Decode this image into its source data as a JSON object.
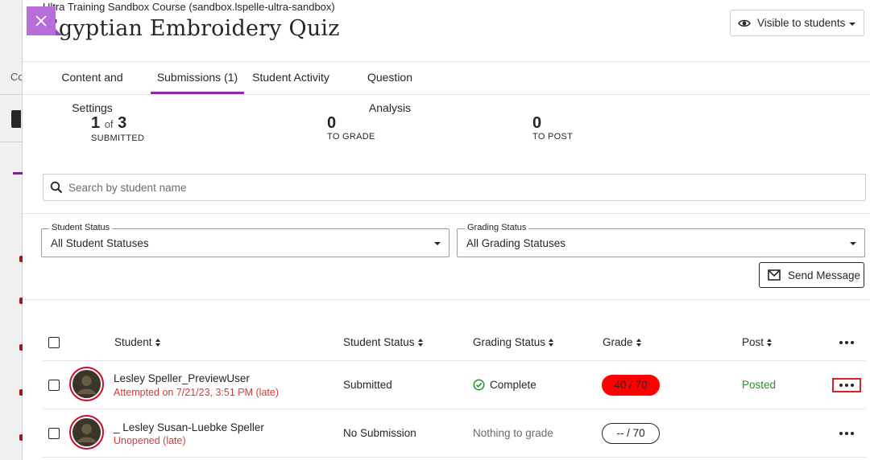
{
  "background": {
    "partial_text": "Co"
  },
  "header": {
    "course_name": "Ultra Training Sandbox Course (sandbox.lspelle-ultra-sandbox)",
    "title": "Egyptian Embroidery Quiz",
    "visibility_label": "Visible to students"
  },
  "tabs": [
    {
      "label": "Content and Settings",
      "active": false
    },
    {
      "label": "Submissions (1)",
      "active": true
    },
    {
      "label": "Student Activity",
      "active": false
    },
    {
      "label": "Question Analysis",
      "active": false
    }
  ],
  "stats": {
    "submitted": {
      "count": "1",
      "of_word": "of",
      "total": "3",
      "label": "SUBMITTED"
    },
    "to_grade": {
      "count": "0",
      "label": "TO GRADE"
    },
    "to_post": {
      "count": "0",
      "label": "TO POST"
    }
  },
  "search": {
    "placeholder": "Search by student name"
  },
  "filters": {
    "student_status": {
      "legend": "Student Status",
      "value": "All Student Statuses"
    },
    "grading_status": {
      "legend": "Grading Status",
      "value": "All Grading Statuses"
    }
  },
  "send_message_label": "Send Message",
  "table": {
    "headers": {
      "student": "Student",
      "student_status": "Student Status",
      "grading_status": "Grading Status",
      "grade": "Grade",
      "post": "Post"
    },
    "rows": [
      {
        "name": "Lesley Speller_PreviewUser",
        "subtext": "Attempted on 7/21/23, 3:51 PM (late)",
        "student_status": "Submitted",
        "grading_status": "Complete",
        "grade": "40  / 70",
        "post": "Posted"
      },
      {
        "name": "_ Lesley Susan-Luebke Speller",
        "subtext": "Unopened (late)",
        "student_status": "No Submission",
        "grading_status": "Nothing to grade",
        "grade": "--  / 70",
        "post": ""
      }
    ]
  },
  "colors": {
    "accent_purple": "#8a2aae",
    "close_button": "#b66ed9",
    "late_red": "#d43b3b",
    "grade_fail": "#ff0000",
    "posted_green": "#2f8a2f"
  },
  "icons": [
    "close-icon",
    "eye-icon",
    "search-icon",
    "envelope-icon",
    "check-circle-icon",
    "more-options-icon",
    "avatar-silhouette-icon"
  ]
}
